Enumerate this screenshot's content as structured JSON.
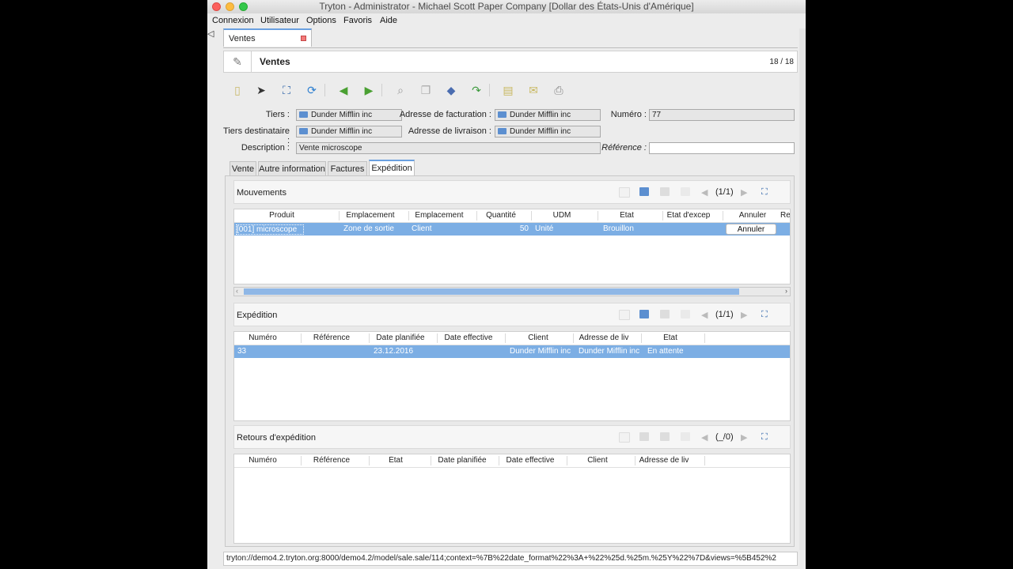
{
  "window": {
    "title": "Tryton - Administrator - Michael Scott Paper Company [Dollar des États-Unis d'Amérique]"
  },
  "menu": [
    "Connexion",
    "Utilisateur",
    "Options",
    "Favoris",
    "Aide"
  ],
  "doc_tab": {
    "label": "Ventes"
  },
  "header": {
    "title": "Ventes",
    "record_count": "18 / 18"
  },
  "toolbar_icons": [
    "new-icon",
    "save-icon",
    "switch-view-icon",
    "reload-icon",
    "previous-icon",
    "next-icon",
    "attachment-icon",
    "copy-icon",
    "action-icon",
    "relate-icon",
    "report-icon",
    "email-icon",
    "print-icon"
  ],
  "form": {
    "tiers_label": "Tiers :",
    "tiers_value": "Dunder Mifflin inc",
    "billing_label": "Adresse de facturation :",
    "billing_value": "Dunder Mifflin inc",
    "number_label": "Numéro :",
    "number_value": "77",
    "recipient_label": "Tiers destinataire :",
    "recipient_value": "Dunder Mifflin inc",
    "delivery_label": "Adresse de livraison :",
    "delivery_value": "Dunder Mifflin inc",
    "description_label": "Description :",
    "description_value": "Vente microscope",
    "reference_label": "Référence :",
    "reference_value": ""
  },
  "form_tabs": [
    "Vente",
    "Autre information",
    "Factures",
    "Expédition"
  ],
  "moves": {
    "title": "Mouvements",
    "pager": "(1/1)",
    "columns": [
      "Produit",
      "Emplacement",
      "Emplacement",
      "Quantité",
      "UDM",
      "Etat",
      "État d'excep",
      "Annuler",
      "Re"
    ],
    "row": {
      "product": "[001] microscope",
      "from": "Zone de sortie",
      "to": "Client",
      "qty": "50",
      "uom": "Unité",
      "state": "Brouillon",
      "exception": "",
      "cancel": "Annuler"
    }
  },
  "shipments": {
    "title": "Expédition",
    "pager": "(1/1)",
    "columns": [
      "Numéro",
      "Référence",
      "Date planifiée",
      "Date effective",
      "Client",
      "Adresse de liv",
      "État"
    ],
    "row": {
      "number": "33",
      "reference": "",
      "planned": "23.12.2016",
      "effective": "",
      "customer": "Dunder Mifflin inc",
      "address": "Dunder Mifflin inc",
      "state": "En attente"
    }
  },
  "returns": {
    "title": "Retours d'expédition",
    "pager": "(_/0)",
    "columns": [
      "Numéro",
      "Référence",
      "État",
      "Date planifiée",
      "Date effective",
      "Client",
      "Adresse de liv"
    ]
  },
  "status_url": "tryton://demo4.2.tryton.org:8000/demo4.2/model/sale.sale/114;context=%7B%22date_format%22%3A+%22%25d.%25m.%25Y%22%7D&views=%5B452%2",
  "colors": {
    "selection": "#7caee4",
    "tab_accent": "#6aa0e0",
    "close": "#fc605c",
    "minimize": "#fdbc40",
    "maximize": "#34c84a"
  }
}
